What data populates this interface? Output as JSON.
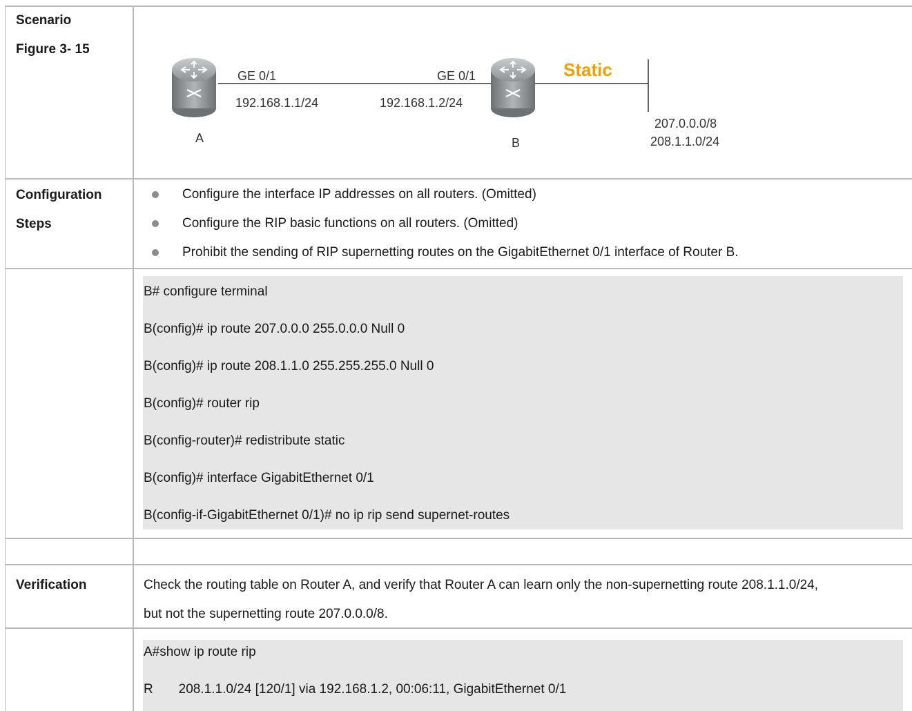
{
  "rows": {
    "scenario": {
      "label": "Scenario",
      "figure_label": "Figure 3- 15"
    },
    "figure": {
      "router_a": {
        "name": "A",
        "interface": "GE 0/1",
        "ip": "192.168.1.1/24"
      },
      "router_b": {
        "name": "B",
        "interface": "GE 0/1",
        "ip": "192.168.1.2/24"
      },
      "static_label": "Static",
      "networks": [
        "207.0.0.0/8",
        "208.1.1.0/24"
      ],
      "colors": {
        "static": "#f0a000",
        "router_body": "#8a8e90",
        "link": "#333333"
      }
    },
    "config_steps": {
      "label_line1": "Configuration",
      "label_line2": "Steps",
      "bullets": [
        "Configure the interface IP addresses on all routers. (Omitted)",
        "Configure the RIP basic functions on all routers. (Omitted)",
        "Prohibit the sending of RIP supernetting routes on the GigabitEthernet 0/1 interface of Router B."
      ]
    },
    "config_code": [
      "B# configure terminal",
      "B(config)# ip route 207.0.0.0 255.0.0.0 Null 0",
      "B(config)# ip route 208.1.1.0 255.255.255.0 Null 0",
      "B(config)# router rip",
      "B(config-router)# redistribute static",
      "B(config)# interface GigabitEthernet 0/1",
      "B(config-if-GigabitEthernet 0/1)# no ip rip send supernet-routes"
    ],
    "verification": {
      "label": "Verification",
      "text_line1": "Check the routing table on Router A, and verify that Router A can learn only the non-supernetting route 208.1.1.0/24,",
      "text_line2": "but not the supernetting route 207.0.0.0/8."
    },
    "verification_code": [
      "A#show ip route rip",
      "R       208.1.1.0/24 [120/1] via 192.168.1.2, 00:06:11, GigabitEthernet 0/1"
    ]
  }
}
